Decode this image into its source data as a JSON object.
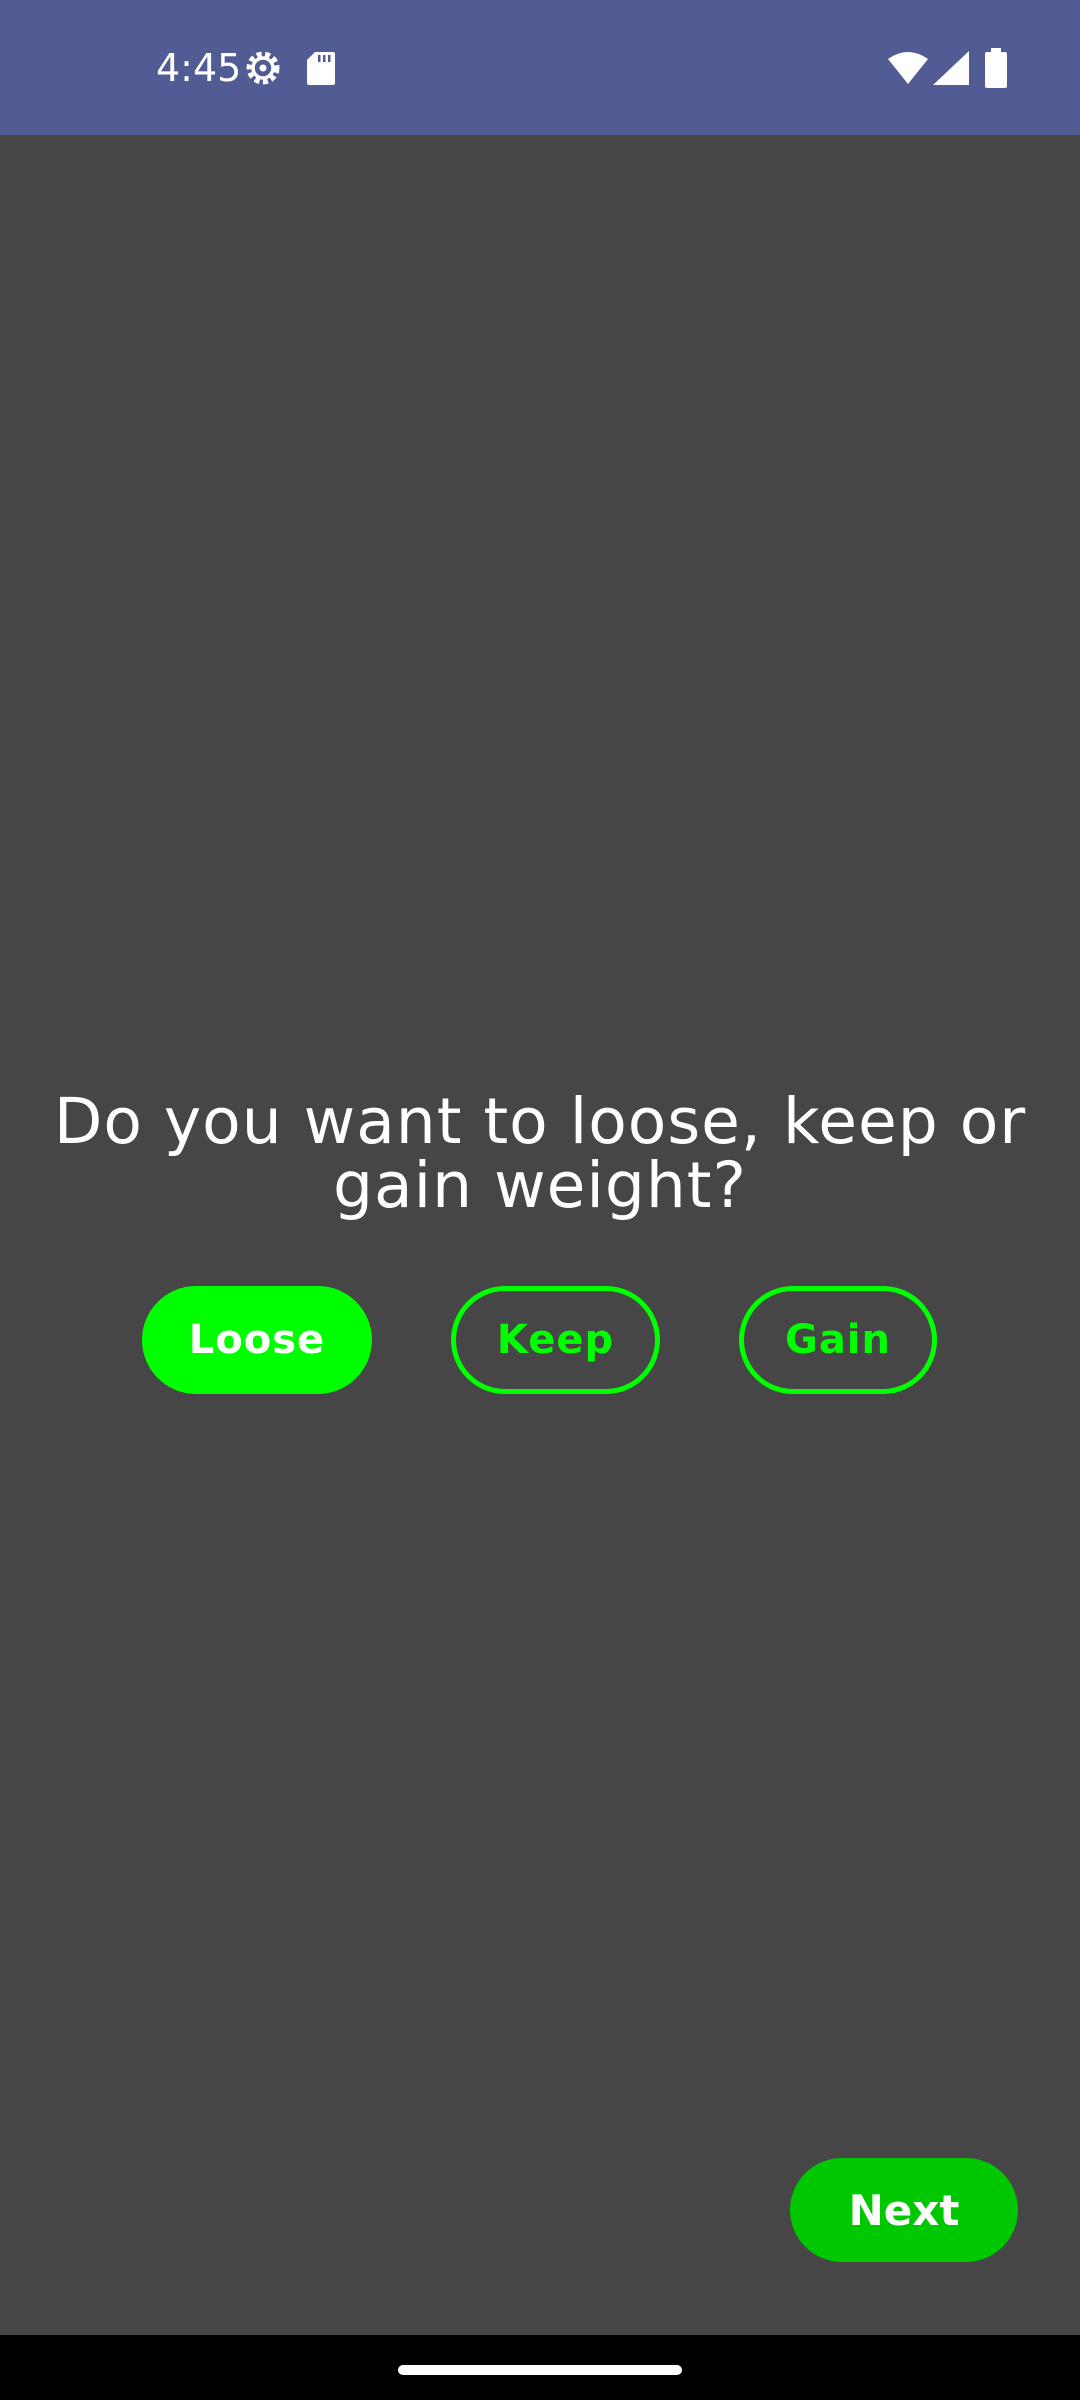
{
  "status_bar": {
    "time": "4:45",
    "icons": {
      "settings": "gear-icon",
      "sd_card": "sd-card-icon",
      "wifi": "wifi-icon",
      "signal": "signal-icon",
      "battery": "battery-icon"
    },
    "background_color": "#525c94"
  },
  "question": {
    "text": "Do you want to loose, keep or gain weight?"
  },
  "options": {
    "loose": "Loose",
    "keep": "Keep",
    "gain": "Gain",
    "selected": "Loose"
  },
  "next_button": {
    "label": "Next"
  },
  "colors": {
    "background": "#464646",
    "accent": "#00ff00",
    "next_button": "#00c800",
    "text": "#ffffff"
  }
}
